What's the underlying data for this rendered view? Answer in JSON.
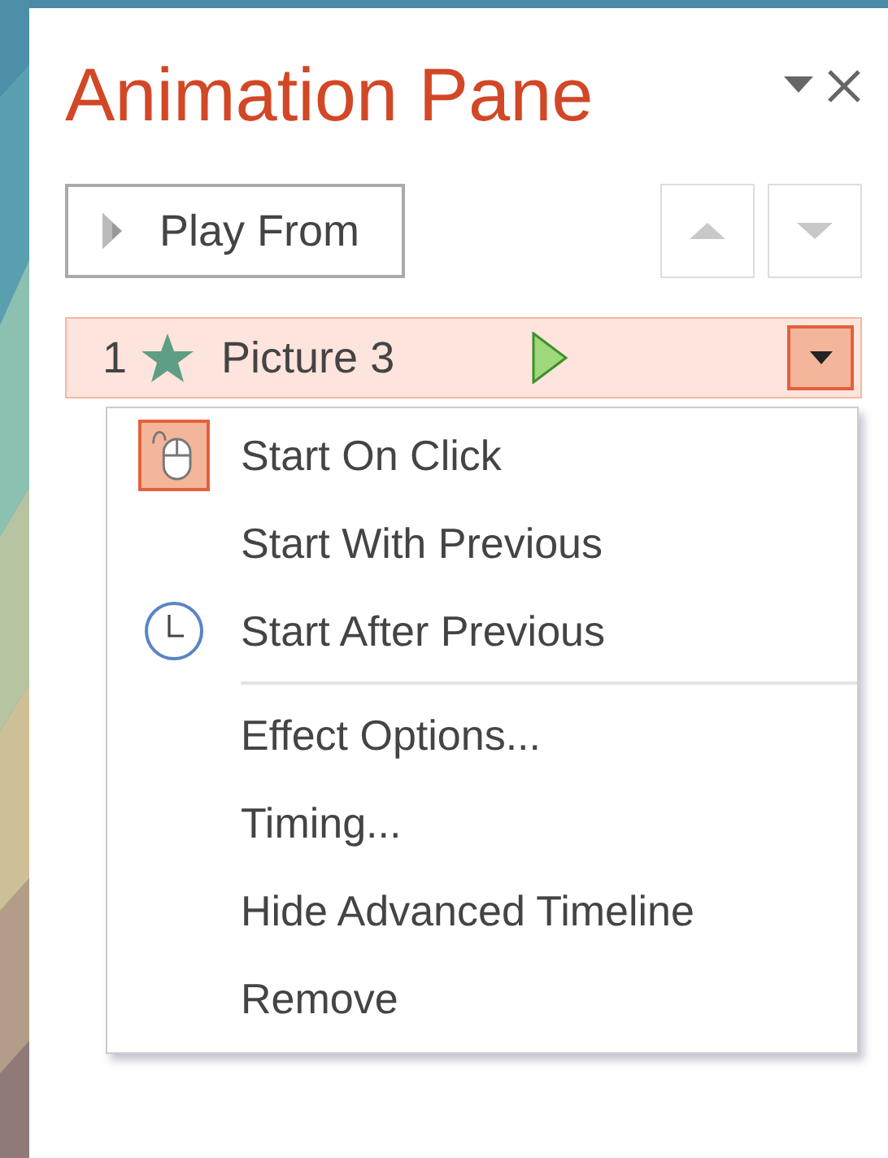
{
  "pane": {
    "title": "Animation Pane",
    "play_button": "Play From",
    "move_up_disabled": true,
    "move_down_disabled": true
  },
  "animation_list": [
    {
      "number": "1",
      "name": "Picture 3",
      "selected": true
    }
  ],
  "context_menu": [
    {
      "kind": "click",
      "label": "Start On Click",
      "checked": true
    },
    {
      "kind": "with",
      "label": "Start With Previous",
      "checked": false
    },
    {
      "kind": "after",
      "label": "Start After Previous",
      "checked": false
    },
    {
      "kind": "separator"
    },
    {
      "kind": "command",
      "label": "Effect Options..."
    },
    {
      "kind": "command",
      "label": "Timing..."
    },
    {
      "kind": "command",
      "label": "Hide Advanced Timeline"
    },
    {
      "kind": "command",
      "label": "Remove"
    }
  ]
}
